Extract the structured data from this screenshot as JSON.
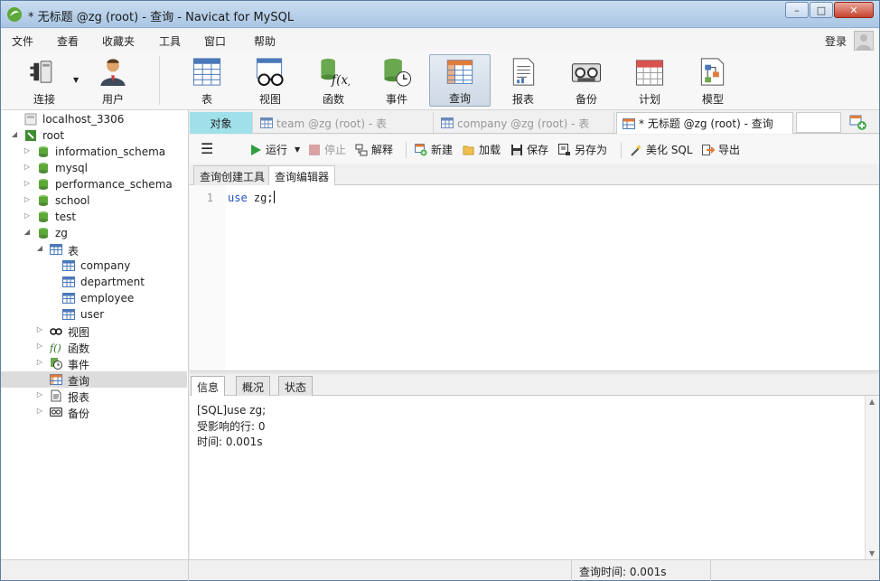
{
  "window": {
    "title": "* 无标题 @zg (root) - 查询 - Navicat for MySQL",
    "minimize": "–",
    "maximize": "□",
    "close": "✕"
  },
  "menu": {
    "items": [
      "文件",
      "查看",
      "收藏夹",
      "工具",
      "窗口",
      "帮助"
    ],
    "login": "登录"
  },
  "toolbar": {
    "buttons": [
      {
        "label": "连接",
        "icon": "plug-icon"
      },
      {
        "label": "用户",
        "icon": "user-icon"
      },
      {
        "label": "表",
        "icon": "table-icon"
      },
      {
        "label": "视图",
        "icon": "view-glasses-icon"
      },
      {
        "label": "函数",
        "icon": "function-icon"
      },
      {
        "label": "事件",
        "icon": "event-clock-icon"
      },
      {
        "label": "查询",
        "icon": "query-icon"
      },
      {
        "label": "报表",
        "icon": "report-icon"
      },
      {
        "label": "备份",
        "icon": "backup-icon"
      },
      {
        "label": "计划",
        "icon": "calendar-icon"
      },
      {
        "label": "模型",
        "icon": "model-icon"
      }
    ],
    "active": "查询"
  },
  "tree": {
    "connections": [
      {
        "label": "localhost_3306"
      },
      {
        "label": "root"
      }
    ],
    "databases": [
      "information_schema",
      "mysql",
      "performance_schema",
      "school",
      "test",
      "zg"
    ],
    "zg_children": {
      "tables_label": "表",
      "tables": [
        "company",
        "department",
        "employee",
        "user"
      ],
      "views_label": "视图",
      "functions_label": "函数",
      "events_label": "事件",
      "queries_label": "查询",
      "reports_label": "报表",
      "backups_label": "备份"
    }
  },
  "tabs": {
    "objects": "对象",
    "items": [
      {
        "label": "team @zg (root) - 表"
      },
      {
        "label": "company @zg (root) - 表"
      },
      {
        "label": "* 无标题 @zg (root) - 查询"
      }
    ]
  },
  "query_toolbar": {
    "run": "运行",
    "stop": "停止",
    "explain": "解释",
    "new": "新建",
    "load": "加载",
    "save": "保存",
    "save_as": "另存为",
    "beautify": "美化 SQL",
    "export": "导出"
  },
  "subtabs": [
    "查询创建工具",
    "查询编辑器"
  ],
  "editor": {
    "line_number": "1",
    "keyword": "use",
    "rest": " zg;"
  },
  "result_tabs": [
    "信息",
    "概况",
    "状态"
  ],
  "message": {
    "line1": "[SQL]use zg;",
    "line2": "受影响的行: 0",
    "line3": "时间: 0.001s"
  },
  "status": {
    "query_time": "查询时间: 0.001s"
  }
}
